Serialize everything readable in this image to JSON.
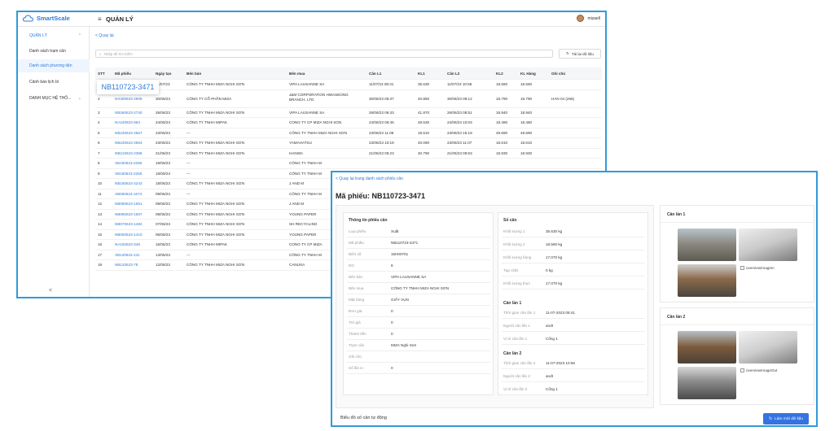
{
  "app": {
    "name": "SmartScale",
    "section_title": "QUẢN LÝ",
    "user": "mizaell"
  },
  "sidebar": {
    "group": "QUẢN LÝ",
    "items": [
      {
        "label": "Danh sách trạm cân"
      },
      {
        "label": "Danh sách phương tiện"
      },
      {
        "label": "Cảnh báo lịch bì"
      },
      {
        "label": "DANH MỤC HỆ THỐ..."
      }
    ],
    "collapse": "<"
  },
  "list": {
    "back": "< Quay lại",
    "search_placeholder": "Nhập để tìm kiếm",
    "reload_label": "Tải lại dữ liệu",
    "tooltip": "NB110723-3471",
    "headers": [
      "STT",
      "Mã phiếu",
      "Ngày tạo",
      "Bên bán",
      "Bên mua",
      "Cân L1",
      "KL1",
      "Cân L2",
      "KL2",
      "KL Hàng",
      "Ghi chú"
    ],
    "rows": [
      [
        "1",
        "NB110723-3471",
        "11/07/23",
        "CÔNG TY TNHH MIZA NGHI SƠN",
        "VIPA LAUSANNE SA",
        "11/07/23 08:41",
        "35.630",
        "11/07/23 10:56",
        "18.560",
        "18.560",
        ""
      ],
      [
        "2",
        "NX300623-2909",
        "30/06/23",
        "CÔNG TY CỔ PHẦN MIZA",
        "J&M CORPORATION HWASEONG BRANCH, LTD",
        "30/06/23 06:37",
        "40.850",
        "30/06/23 08:12",
        "18.790",
        "18.790",
        "HAN 04 (266)"
      ],
      [
        "3",
        "NB260623-2740",
        "26/06/23",
        "CÔNG TY TNHH MIZA NGHI SƠN",
        "VIPA LAUSANNE SA",
        "26/06/23 06:43",
        "41.870",
        "26/06/23 08:51",
        "18.940",
        "18.940",
        ""
      ],
      [
        "4",
        "NA240623-963",
        "24/06/23",
        "CÔNG TY TNHH MIPAK",
        "CONG TY CP MIZA NGHI SON",
        "24/06/23 06:45",
        "48.530",
        "24/06/23 10:03",
        "18.480",
        "18.480",
        ""
      ],
      [
        "5",
        "NB230623-2567",
        "23/06/23",
        "---",
        "CÔNG TY TNHH MIZA NGHI SƠN",
        "23/06/23 11:08",
        "18.610",
        "23/06/23 15:19",
        "49.690",
        "49.690",
        ""
      ],
      [
        "6",
        "NB230623-2563",
        "23/06/23",
        "CÔNG TY TNHH MIZA NGHI SƠN",
        "YAMAHATSU",
        "23/06/23 10:18",
        "40.090",
        "23/06/23 11:07",
        "18.610",
        "18.610",
        ""
      ],
      [
        "7",
        "NB210623-2399",
        "21/06/23",
        "CÔNG TY TNHH MIZA NGHI SƠN",
        "HANWA",
        "21/06/23 06:23",
        "40.790",
        "21/06/23 09:53",
        "18.930",
        "18.930",
        ""
      ],
      [
        "8",
        "XB190623-2286",
        "19/06/23",
        "---",
        "CÔNG TY TNHH M",
        "",
        "",
        "",
        "",
        "",
        ""
      ],
      [
        "9",
        "XB180623-2258",
        "18/06/23",
        "---",
        "CÔNG TY TNHH M",
        "",
        "",
        "",
        "",
        "",
        ""
      ],
      [
        "10",
        "NB180623-2243",
        "18/06/23",
        "CÔNG TY TNHH MIZA NGHI SƠN",
        "J AND M",
        "",
        "",
        "",
        "",
        "",
        ""
      ],
      [
        "11",
        "XB090623-1674",
        "09/06/23",
        "---",
        "CÔNG TY TNHH M",
        "",
        "",
        "",
        "",
        "",
        ""
      ],
      [
        "12",
        "NB090623-1651",
        "09/06/23",
        "CÔNG TY TNHH MIZA NGHI SƠN",
        "J AND M",
        "",
        "",
        "",
        "",
        "",
        ""
      ],
      [
        "13",
        "NB080623-1567",
        "08/06/23",
        "CÔNG TY TNHH MIZA NGHI SƠN",
        "YOUNG PAPER",
        "",
        "",
        "",
        "",
        "",
        ""
      ],
      [
        "14",
        "NB070623-1482",
        "07/06/23",
        "CÔNG TY TNHH MIZA NGHI SƠN",
        "SH RECYCLING",
        "",
        "",
        "",
        "",
        "",
        ""
      ],
      [
        "15",
        "NB060623-1410",
        "06/06/23",
        "CÔNG TY TNHH MIZA NGHI SƠN",
        "YOUNG PAPER",
        "",
        "",
        "",
        "",
        "",
        ""
      ],
      [
        "16",
        "NA150523-348",
        "15/05/23",
        "CÔNG TY TNHH MIPAK",
        "CONG TY CP MIZA",
        "",
        "",
        "",
        "",
        "",
        ""
      ],
      [
        "17",
        "XB130523-131",
        "13/05/23",
        "---",
        "CÔNG TY TNHH M",
        "",
        "",
        "",
        "",
        "",
        ""
      ],
      [
        "18",
        "NB120523-78",
        "12/05/23",
        "CÔNG TY TNHH MIZA NGHI SƠN",
        "CANUSA",
        "",
        "",
        "",
        "",
        "",
        ""
      ]
    ]
  },
  "detail": {
    "back": "< Quay lại trang danh sách phiếu cân",
    "title": "Mã phiếu: NB110723-3471",
    "info_title": "Thông tin phiếu cân",
    "info": [
      {
        "k": "Loại phiếu",
        "v": "Xuất"
      },
      {
        "k": "Mã phiếu",
        "v": "NB110723-3471"
      },
      {
        "k": "Biển số",
        "v": "15H00761"
      },
      {
        "k": "DO",
        "v": "8"
      },
      {
        "k": "Bên bán",
        "v": "VIPA LAUSANNE SA"
      },
      {
        "k": "Bên mua",
        "v": "CÔNG TY TNHH MIZA NGHI SƠN"
      },
      {
        "k": "Mặt hàng",
        "v": "GIẤY VỤN"
      },
      {
        "k": "Đơn giá",
        "v": "0"
      },
      {
        "k": "Trừ giá",
        "v": "0"
      },
      {
        "k": "Thành tiền",
        "v": "0"
      },
      {
        "k": "Trạm cân",
        "v": "MIZA Nghi Sơn"
      },
      {
        "k": "Ghi chú",
        "v": ""
      },
      {
        "k": "Số lần in",
        "v": "0"
      }
    ],
    "weigh_title": "Số cân",
    "weigh": [
      {
        "k": "Khối lượng 1",
        "v": "35.630 kg"
      },
      {
        "k": "Khối lượng 2",
        "v": "18.560 kg"
      },
      {
        "k": "Khối lượng hàng",
        "v": "17.070 kg"
      },
      {
        "k": "Tạp chất",
        "v": "0 kg"
      },
      {
        "k": "Khối lượng thực",
        "v": "17.070 kg"
      }
    ],
    "l1_title": "Cân lần 1",
    "l1": [
      {
        "k": "Thời gian cân lần 1",
        "v": "11-07-2023 08:41"
      },
      {
        "k": "Người cân lần 1",
        "v": "andt"
      },
      {
        "k": "Vị trí cân lần 1",
        "v": "Cổng 1"
      }
    ],
    "l2_title": "Cân lần 2",
    "l2": [
      {
        "k": "Thời gian cân lần 2",
        "v": "11-07-2023 10:56"
      },
      {
        "k": "Người cân lần 2",
        "v": "andt"
      },
      {
        "k": "Vị trí cân lần 2",
        "v": "Cổng 1"
      }
    ],
    "img1_title": "Cân lần 1",
    "img1_alt": "overviewImageIn",
    "img2_title": "Cân lần 2",
    "img2_alt": "overviewImageOut",
    "chart_title": "Biểu đồ số cân tự động",
    "refresh_label": "Làm mới dữ liệu"
  },
  "colors": {
    "accent": "#2f7bd8",
    "frame": "#2f9bd8",
    "button": "#3573e0"
  }
}
